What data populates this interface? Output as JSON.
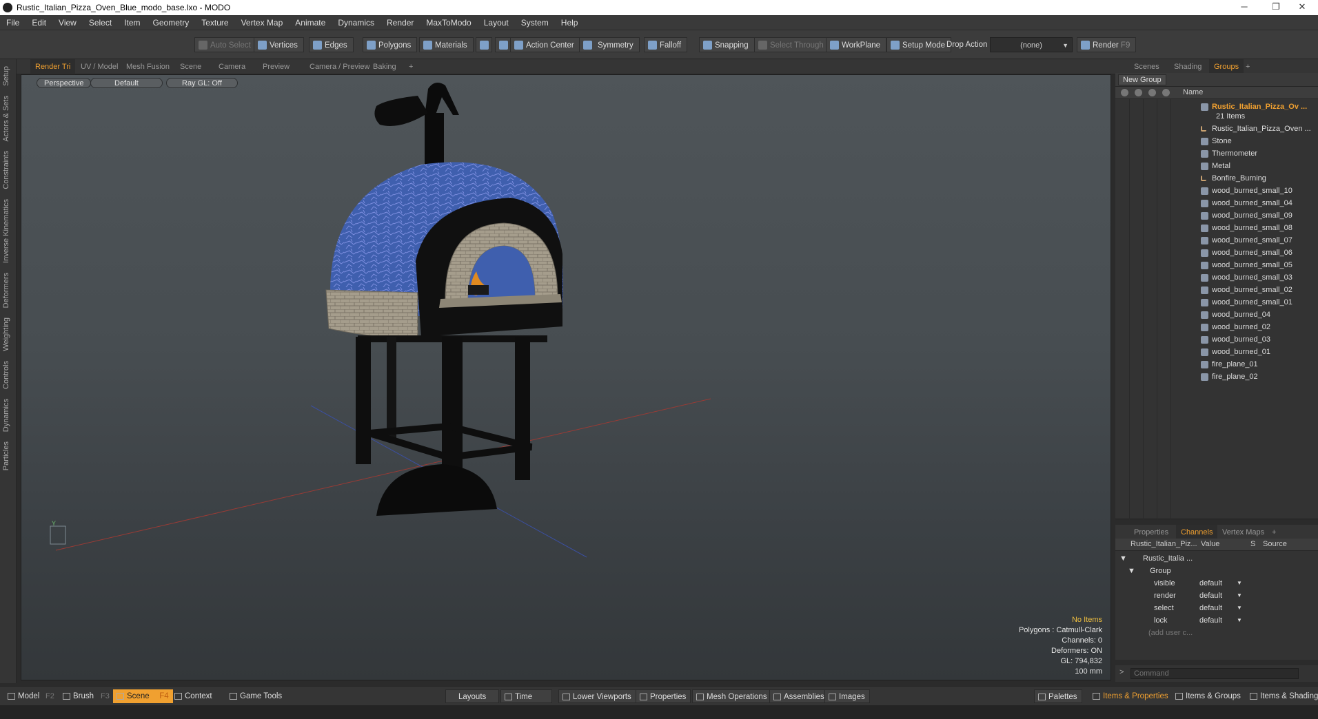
{
  "window": {
    "title": "Rustic_Italian_Pizza_Oven_Blue_modo_base.lxo - MODO",
    "minimize": "─",
    "maximize": "❐",
    "close": "✕"
  },
  "menu": [
    "File",
    "Edit",
    "View",
    "Select",
    "Item",
    "Geometry",
    "Texture",
    "Vertex Map",
    "Animate",
    "Dynamics",
    "Render",
    "MaxToModo",
    "Layout",
    "System",
    "Help"
  ],
  "toolbar": {
    "auto_select": "Auto Select",
    "vertices": "Vertices",
    "edges": "Edges",
    "polygons": "Polygons",
    "materials": "Materials",
    "action_center": "Action Center",
    "symmetry": "Symmetry",
    "falloff": "Falloff",
    "snapping": "Snapping",
    "select_through": "Select Through",
    "workplane": "WorkPlane",
    "setup_mode": "Setup Mode",
    "drop_action_label": "Drop Action",
    "drop_action_value": "(none)",
    "render": "Render",
    "render_key": "F9"
  },
  "left_tabs": [
    "Setup",
    "Actors & Sets",
    "Constraints",
    "Inverse Kinematics",
    "Deformers",
    "Weighting",
    "Controls",
    "Dynamics",
    "Particles"
  ],
  "viewport_tabs": [
    "Render Tri",
    "UV / Model",
    "Mesh Fusion",
    "Scene",
    "Camera",
    "Preview",
    "Camera / Preview",
    "Baking",
    "+"
  ],
  "viewport": {
    "view_mode": "Perspective",
    "shading": "Default",
    "raygl": "Ray GL: Off",
    "info": {
      "selection": "No Items",
      "polygons": "Polygons : Catmull-Clark",
      "channels": "Channels: 0",
      "deformers": "Deformers: ON",
      "gl": "GL: 794,832",
      "scale": "100 mm"
    },
    "axis_label": "Y"
  },
  "right_tabs": [
    "Scenes",
    "Shading",
    "Groups",
    "+"
  ],
  "groups": {
    "new_group": "New Group",
    "name_header": "Name",
    "group_name": "Rustic_Italian_Pizza_Ov ...",
    "item_count": "21 Items",
    "items": [
      {
        "label": "Rustic_Italian_Pizza_Oven ...",
        "kind": "locator"
      },
      {
        "label": "Stone",
        "kind": "mesh"
      },
      {
        "label": "Thermometer",
        "kind": "mesh"
      },
      {
        "label": "Metal",
        "kind": "mesh"
      },
      {
        "label": "Bonfire_Burning",
        "kind": "locator"
      },
      {
        "label": "wood_burned_small_10",
        "kind": "mesh"
      },
      {
        "label": "wood_burned_small_04",
        "kind": "mesh"
      },
      {
        "label": "wood_burned_small_09",
        "kind": "mesh"
      },
      {
        "label": "wood_burned_small_08",
        "kind": "mesh"
      },
      {
        "label": "wood_burned_small_07",
        "kind": "mesh"
      },
      {
        "label": "wood_burned_small_06",
        "kind": "mesh"
      },
      {
        "label": "wood_burned_small_05",
        "kind": "mesh"
      },
      {
        "label": "wood_burned_small_03",
        "kind": "mesh"
      },
      {
        "label": "wood_burned_small_02",
        "kind": "mesh"
      },
      {
        "label": "wood_burned_small_01",
        "kind": "mesh"
      },
      {
        "label": "wood_burned_04",
        "kind": "mesh"
      },
      {
        "label": "wood_burned_02",
        "kind": "mesh"
      },
      {
        "label": "wood_burned_03",
        "kind": "mesh"
      },
      {
        "label": "wood_burned_01",
        "kind": "mesh"
      },
      {
        "label": "fire_plane_01",
        "kind": "mesh"
      },
      {
        "label": "fire_plane_02",
        "kind": "mesh"
      }
    ]
  },
  "props_tabs": [
    "Properties",
    "Channels",
    "Vertex Maps",
    "+"
  ],
  "channels": {
    "headers": {
      "name": "Rustic_Italian_Piz...",
      "value": "Value",
      "s": "S",
      "source": "Source"
    },
    "root": "Rustic_Italia ...",
    "group": "Group",
    "rows": [
      {
        "name": "visible",
        "value": "default"
      },
      {
        "name": "render",
        "value": "default"
      },
      {
        "name": "select",
        "value": "default"
      },
      {
        "name": "lock",
        "value": "default"
      }
    ],
    "add_user": "(add user c..."
  },
  "command": {
    "placeholder": "Command"
  },
  "bottom": {
    "model": "Model",
    "model_key": "F2",
    "brush": "Brush",
    "brush_key": "F3",
    "scene": "Scene",
    "scene_key": "F4",
    "context": "Context",
    "game_tools": "Game Tools",
    "layouts": "Layouts",
    "time": "Time",
    "lower_viewports": "Lower Viewports",
    "properties": "Properties",
    "mesh_operations": "Mesh Operations",
    "assemblies": "Assemblies",
    "images": "Images",
    "palettes": "Palettes",
    "items_properties": "Items & Properties",
    "items_groups": "Items & Groups",
    "items_shading": "Items & Shading"
  },
  "colors": {
    "accent": "#f0a030",
    "oven_blue": "#4a6ab8"
  }
}
